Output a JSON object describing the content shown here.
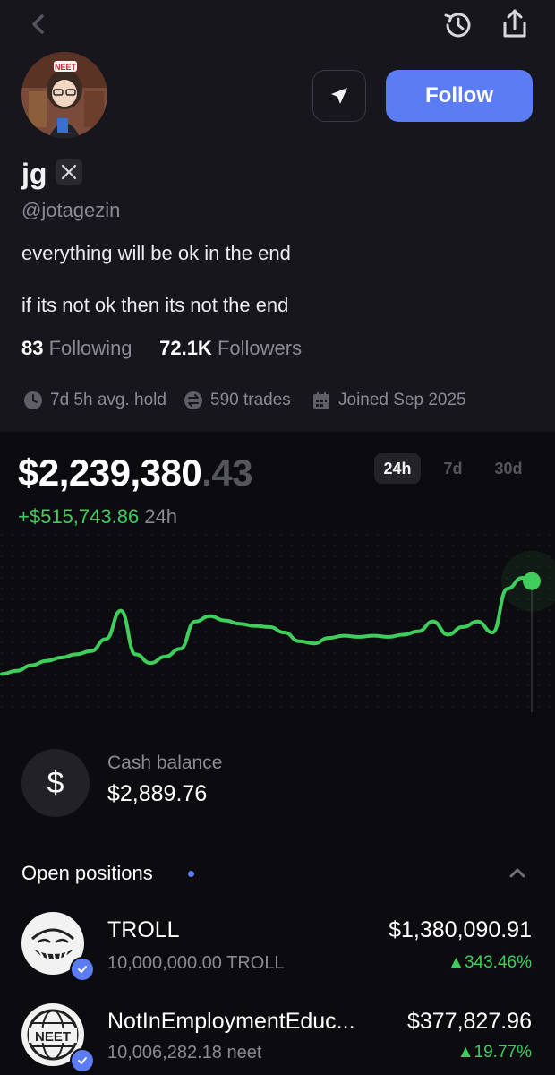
{
  "profile": {
    "name": "jg",
    "handle": "@jotagezin",
    "avatar_badge": "NEET",
    "bio_line1": "everything will be ok in the end",
    "bio_line2": "if its not ok then its not the end",
    "following_count": "83",
    "following_label": "Following",
    "followers_count": "72.1K",
    "followers_label": "Followers",
    "follow_button": "Follow",
    "avg_hold": "7d 5h avg. hold",
    "trades": "590 trades",
    "joined": "Joined Sep 2025"
  },
  "portfolio": {
    "value_main": "$2,239,380",
    "value_decimals": ".43",
    "change_amount": "+$515,743.86",
    "change_period": "24h",
    "timeframes": [
      "24h",
      "7d",
      "30d"
    ],
    "active_timeframe": "24h",
    "accent_color": "#3fce5c"
  },
  "chart_data": {
    "type": "line",
    "series": [
      {
        "values": [
          0.12,
          0.15,
          0.2,
          0.24,
          0.27,
          0.3,
          0.33,
          0.44,
          0.7,
          0.3,
          0.22,
          0.28,
          0.35,
          0.6,
          0.65,
          0.61,
          0.58,
          0.56,
          0.55,
          0.5,
          0.42,
          0.4,
          0.45,
          0.47,
          0.46,
          0.47,
          0.46,
          0.48,
          0.51,
          0.6,
          0.48,
          0.55,
          0.6,
          0.5,
          0.9,
          1.0,
          0.97
        ]
      }
    ]
  },
  "cash": {
    "label": "Cash balance",
    "value": "$2,889.76",
    "icon": "dollar-icon"
  },
  "positions": {
    "title": "Open positions",
    "items": [
      {
        "name": "TROLL",
        "amount": "10,000,000.00 TROLL",
        "value": "$1,380,090.91",
        "change": "343.46%",
        "icon": "troll-face-icon"
      },
      {
        "name": "NotInEmploymentEduc...",
        "amount": "10,006,282.18 neet",
        "value": "$377,827.96",
        "change": "19.77%",
        "icon": "neet-globe-icon"
      }
    ]
  }
}
